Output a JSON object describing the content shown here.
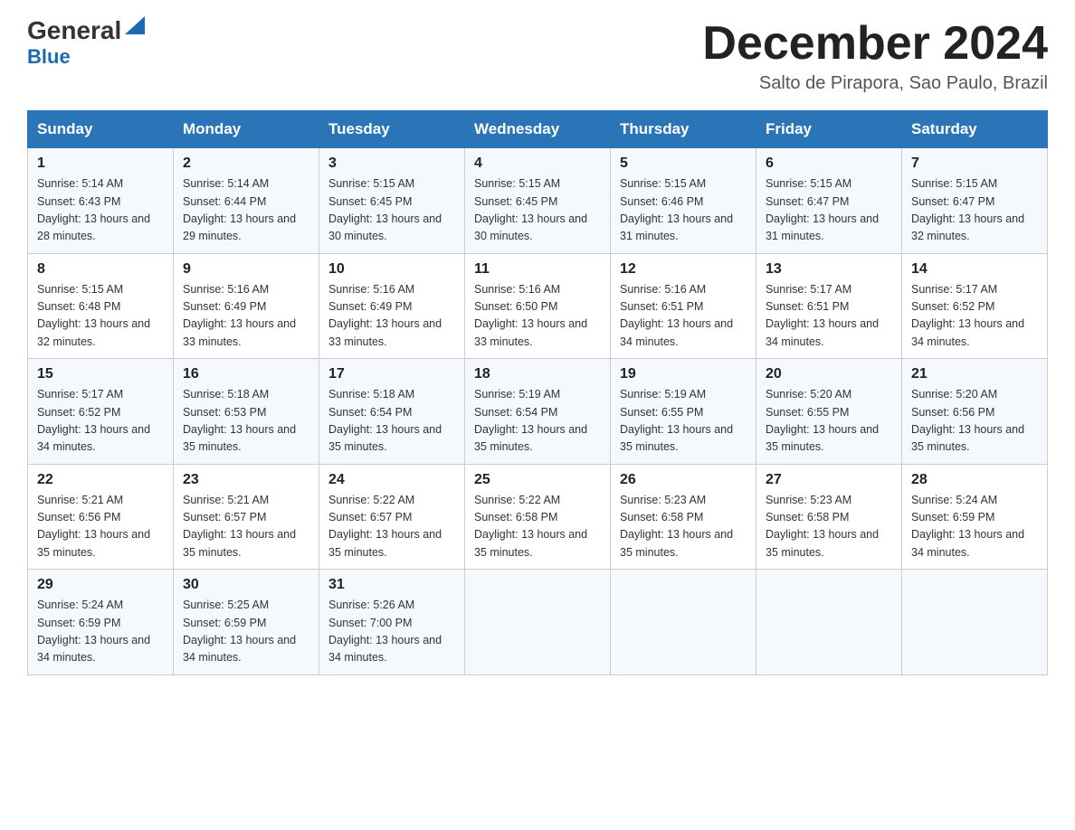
{
  "header": {
    "logo_main": "General",
    "logo_blue": "Blue",
    "month_title": "December 2024",
    "subtitle": "Salto de Pirapora, Sao Paulo, Brazil"
  },
  "weekdays": [
    "Sunday",
    "Monday",
    "Tuesday",
    "Wednesday",
    "Thursday",
    "Friday",
    "Saturday"
  ],
  "weeks": [
    [
      {
        "day": "1",
        "sunrise": "5:14 AM",
        "sunset": "6:43 PM",
        "daylight": "13 hours and 28 minutes."
      },
      {
        "day": "2",
        "sunrise": "5:14 AM",
        "sunset": "6:44 PM",
        "daylight": "13 hours and 29 minutes."
      },
      {
        "day": "3",
        "sunrise": "5:15 AM",
        "sunset": "6:45 PM",
        "daylight": "13 hours and 30 minutes."
      },
      {
        "day": "4",
        "sunrise": "5:15 AM",
        "sunset": "6:45 PM",
        "daylight": "13 hours and 30 minutes."
      },
      {
        "day": "5",
        "sunrise": "5:15 AM",
        "sunset": "6:46 PM",
        "daylight": "13 hours and 31 minutes."
      },
      {
        "day": "6",
        "sunrise": "5:15 AM",
        "sunset": "6:47 PM",
        "daylight": "13 hours and 31 minutes."
      },
      {
        "day": "7",
        "sunrise": "5:15 AM",
        "sunset": "6:47 PM",
        "daylight": "13 hours and 32 minutes."
      }
    ],
    [
      {
        "day": "8",
        "sunrise": "5:15 AM",
        "sunset": "6:48 PM",
        "daylight": "13 hours and 32 minutes."
      },
      {
        "day": "9",
        "sunrise": "5:16 AM",
        "sunset": "6:49 PM",
        "daylight": "13 hours and 33 minutes."
      },
      {
        "day": "10",
        "sunrise": "5:16 AM",
        "sunset": "6:49 PM",
        "daylight": "13 hours and 33 minutes."
      },
      {
        "day": "11",
        "sunrise": "5:16 AM",
        "sunset": "6:50 PM",
        "daylight": "13 hours and 33 minutes."
      },
      {
        "day": "12",
        "sunrise": "5:16 AM",
        "sunset": "6:51 PM",
        "daylight": "13 hours and 34 minutes."
      },
      {
        "day": "13",
        "sunrise": "5:17 AM",
        "sunset": "6:51 PM",
        "daylight": "13 hours and 34 minutes."
      },
      {
        "day": "14",
        "sunrise": "5:17 AM",
        "sunset": "6:52 PM",
        "daylight": "13 hours and 34 minutes."
      }
    ],
    [
      {
        "day": "15",
        "sunrise": "5:17 AM",
        "sunset": "6:52 PM",
        "daylight": "13 hours and 34 minutes."
      },
      {
        "day": "16",
        "sunrise": "5:18 AM",
        "sunset": "6:53 PM",
        "daylight": "13 hours and 35 minutes."
      },
      {
        "day": "17",
        "sunrise": "5:18 AM",
        "sunset": "6:54 PM",
        "daylight": "13 hours and 35 minutes."
      },
      {
        "day": "18",
        "sunrise": "5:19 AM",
        "sunset": "6:54 PM",
        "daylight": "13 hours and 35 minutes."
      },
      {
        "day": "19",
        "sunrise": "5:19 AM",
        "sunset": "6:55 PM",
        "daylight": "13 hours and 35 minutes."
      },
      {
        "day": "20",
        "sunrise": "5:20 AM",
        "sunset": "6:55 PM",
        "daylight": "13 hours and 35 minutes."
      },
      {
        "day": "21",
        "sunrise": "5:20 AM",
        "sunset": "6:56 PM",
        "daylight": "13 hours and 35 minutes."
      }
    ],
    [
      {
        "day": "22",
        "sunrise": "5:21 AM",
        "sunset": "6:56 PM",
        "daylight": "13 hours and 35 minutes."
      },
      {
        "day": "23",
        "sunrise": "5:21 AM",
        "sunset": "6:57 PM",
        "daylight": "13 hours and 35 minutes."
      },
      {
        "day": "24",
        "sunrise": "5:22 AM",
        "sunset": "6:57 PM",
        "daylight": "13 hours and 35 minutes."
      },
      {
        "day": "25",
        "sunrise": "5:22 AM",
        "sunset": "6:58 PM",
        "daylight": "13 hours and 35 minutes."
      },
      {
        "day": "26",
        "sunrise": "5:23 AM",
        "sunset": "6:58 PM",
        "daylight": "13 hours and 35 minutes."
      },
      {
        "day": "27",
        "sunrise": "5:23 AM",
        "sunset": "6:58 PM",
        "daylight": "13 hours and 35 minutes."
      },
      {
        "day": "28",
        "sunrise": "5:24 AM",
        "sunset": "6:59 PM",
        "daylight": "13 hours and 34 minutes."
      }
    ],
    [
      {
        "day": "29",
        "sunrise": "5:24 AM",
        "sunset": "6:59 PM",
        "daylight": "13 hours and 34 minutes."
      },
      {
        "day": "30",
        "sunrise": "5:25 AM",
        "sunset": "6:59 PM",
        "daylight": "13 hours and 34 minutes."
      },
      {
        "day": "31",
        "sunrise": "5:26 AM",
        "sunset": "7:00 PM",
        "daylight": "13 hours and 34 minutes."
      },
      null,
      null,
      null,
      null
    ]
  ]
}
